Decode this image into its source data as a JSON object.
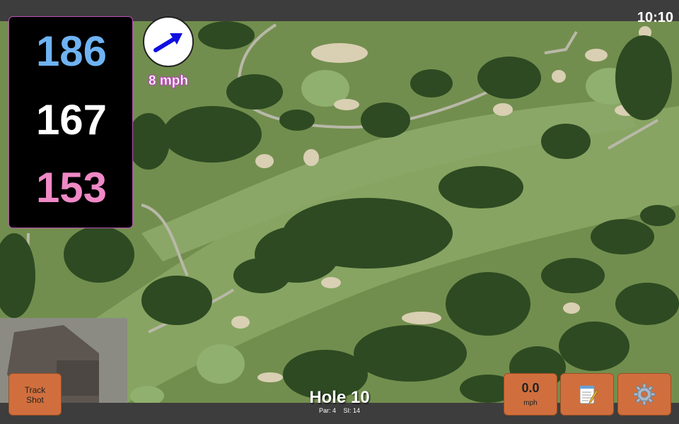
{
  "status": {
    "time": "10:10"
  },
  "distances": {
    "back": "186",
    "middle": "167",
    "front": "153"
  },
  "colors": {
    "back": "#6fb3f3",
    "middle": "#ffffff",
    "front": "#ef89c6",
    "button": "#d06f3d",
    "panel_border": "#b84fb6",
    "wind_arrow": "#1010e0"
  },
  "wind": {
    "speed": "8 mph",
    "direction_icon": "arrow-up-right-icon"
  },
  "buttons": {
    "track_shot": "Track\nShot",
    "speed_value": "0.0",
    "speed_unit": "mph",
    "notes_icon": "notepad-icon",
    "settings_icon": "gear-icon"
  },
  "hole": {
    "title": "Hole 10",
    "par": "Par: 4",
    "stroke_index": "SI: 14"
  }
}
